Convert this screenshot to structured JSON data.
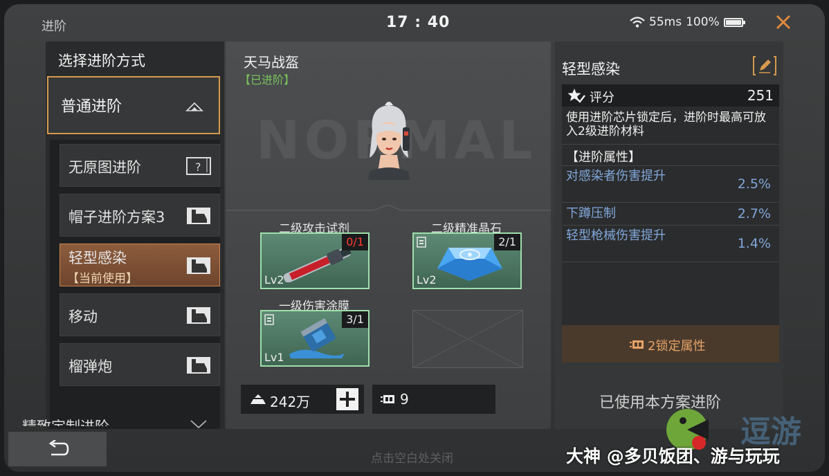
{
  "header": {
    "title": "进阶",
    "clock": "17 : 40",
    "ping": "55ms",
    "battery": "100%"
  },
  "left": {
    "title": "选择进阶方式",
    "main_option": "普通进阶",
    "options": [
      {
        "label": "无原图进阶"
      },
      {
        "label": "帽子进阶方案3"
      },
      {
        "label": "轻型感染",
        "status": "【当前使用】"
      },
      {
        "label": "移动"
      },
      {
        "label": "榴弹炮"
      }
    ],
    "cut_off_item": "精致定制进阶"
  },
  "middle": {
    "item_name": "天马战盔",
    "item_state": "【已进阶】",
    "bg_text": "NORMAL",
    "materials": [
      {
        "name": "二级攻击试剂",
        "count": "0/1",
        "level": "Lv2",
        "insufficient": true
      },
      {
        "name": "二级精准晶石",
        "count": "2/1",
        "level": "Lv2",
        "insufficient": false
      },
      {
        "name": "一级伤害涂膜",
        "count": "3/1",
        "level": "Lv1",
        "insufficient": false
      }
    ],
    "currency": "242万",
    "chips": "9",
    "hint": "点击空白处关闭"
  },
  "right": {
    "title": "轻型感染",
    "score_label": "评分",
    "score": "251",
    "description": "使用进阶芯片锁定后，进阶时最高可放入2级进阶材料",
    "section_title": "【进阶属性】",
    "attributes": [
      {
        "name": "对感染者伤害提升",
        "value": "2.5%"
      },
      {
        "name": "下蹲压制",
        "value": "2.7%"
      },
      {
        "name": "轻型枪械伤害提升",
        "value": "1.4%"
      }
    ],
    "lock_label": "2锁定属性",
    "used_text": "已使用本方案进阶"
  },
  "watermark": {
    "text": "大神 @多贝饭团、游与玩玩",
    "logo_text": "逗游"
  },
  "colors": {
    "accent": "#d79a4e",
    "active_option": "#8d5c3d",
    "attr_blue": "#80a7da",
    "green": "#79c55d",
    "red_count": "#ff3b30",
    "lock_orange": "#e6a367"
  }
}
